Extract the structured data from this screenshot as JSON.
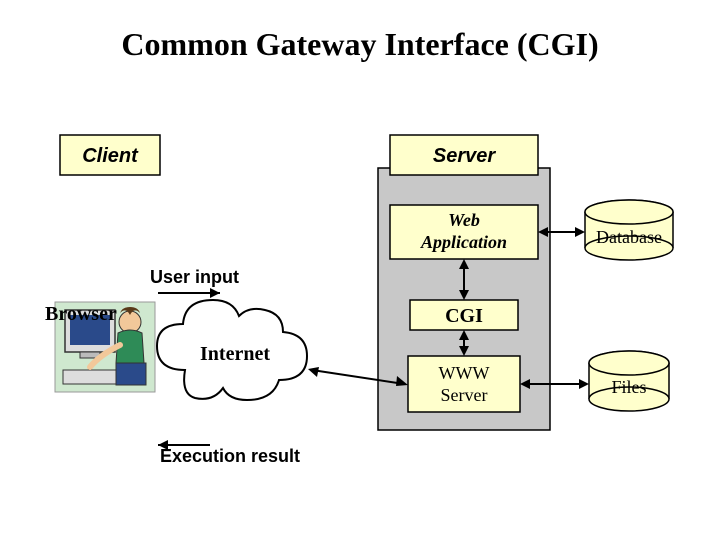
{
  "title": "Common Gateway Interface (CGI)",
  "client_label": "Client",
  "server_label": "Server",
  "webapp_label_line1": "Web",
  "webapp_label_line2": "Application",
  "cgi_label": "CGI",
  "www_label_line1": "WWW",
  "www_label_line2": "Server",
  "database_label": "Database",
  "files_label": "Files",
  "browser_label": "Browser",
  "internet_label": "Internet",
  "user_input_label": "User input",
  "exec_result_label": "Execution result",
  "colors": {
    "box_fill": "#FFFFCC",
    "box_stroke": "#000000",
    "server_panel_fill": "#C8C8C8",
    "cylinder_fill": "#FFFFCC",
    "title_color": "#000000"
  }
}
